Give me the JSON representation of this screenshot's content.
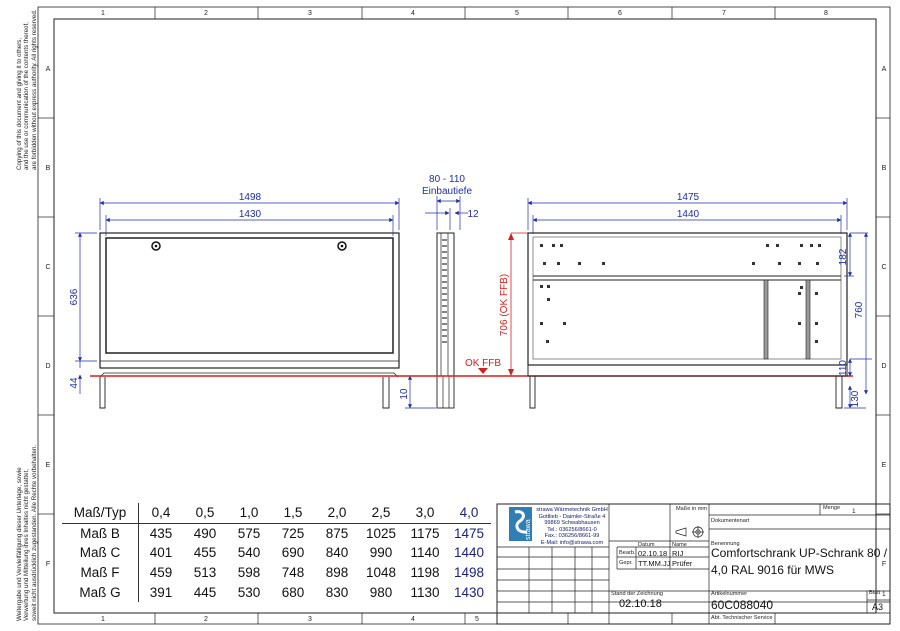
{
  "frame": {
    "col_numbers": [
      "1",
      "2",
      "3",
      "4",
      "5",
      "6",
      "7",
      "8"
    ],
    "row_letters": [
      "A",
      "B",
      "C",
      "D",
      "E",
      "F"
    ]
  },
  "side_notes": {
    "copyright_en": [
      "Copying of this document and giving it to others,",
      "and the use or communication of the contents thereof,",
      "are forbidden without express authority. All rights reserved."
    ],
    "copyright_de": [
      "Weitergabe und Vervielfältigung dieser Unterlage, sowie",
      "Verwertung und Mitteilung ihres Inhaltes nicht gestattet,",
      "soweit nicht ausdrücklich zugestanden. Alle Rechte vorbehalten."
    ]
  },
  "front_view": {
    "dim_overall_width": "1498",
    "dim_inner_width": "1430",
    "dim_height": "636",
    "dim_offset": "44"
  },
  "side_view": {
    "depth_range": "80 - 110",
    "depth_label": "Einbautiefe",
    "dim_frame": "12",
    "dim_foot": "10",
    "ok_ffb_label": "OK FFB",
    "height_label": "706 (OK FFB)"
  },
  "back_view": {
    "dim_overall_width": "1475",
    "dim_inner_width": "1440",
    "dim_top": "182",
    "dim_height": "760",
    "dim_bottom": "110",
    "dim_foot": "130"
  },
  "dimension_table": {
    "header_label": "Maß/Typ",
    "types": [
      "0,4",
      "0,5",
      "1,0",
      "1,5",
      "2,0",
      "2,5",
      "3,0",
      "4,0"
    ],
    "rows": [
      {
        "label": "Maß B",
        "values": [
          "435",
          "490",
          "575",
          "725",
          "875",
          "1025",
          "1175",
          "1475"
        ]
      },
      {
        "label": "Maß C",
        "values": [
          "401",
          "455",
          "540",
          "690",
          "840",
          "990",
          "1140",
          "1440"
        ]
      },
      {
        "label": "Maß F",
        "values": [
          "459",
          "513",
          "598",
          "748",
          "898",
          "1048",
          "1198",
          "1498"
        ]
      },
      {
        "label": "Maß G",
        "values": [
          "391",
          "445",
          "530",
          "680",
          "830",
          "980",
          "1130",
          "1430"
        ]
      }
    ]
  },
  "title_block": {
    "company_address": "strawa Wärmetechnik GmbH\nGottlieb - Daimler-Straße 4\n99869 Schwabhausen\nTel.: 036256/8661-0\nFax.: 036256/8661-99\nE-Mail: info@strawa.com",
    "logo_text": "strawa",
    "masse_label": "Maße in mm",
    "menge_label": "Menge",
    "menge_value": "1",
    "dokumentenart_label": "Dokumentenart",
    "benennung_label": "Benennung",
    "benennung_line1": "Comfortschrank UP-Schrank 80 /",
    "benennung_line2": "4,0 RAL 9016 für MWS",
    "datum_label": "Datum",
    "name_label": "Name",
    "bearb_label": "Bearb.",
    "bearb_date": "02.10.18",
    "bearb_name": "RIJ",
    "gepr_label": "Gepr.",
    "gepr_date": "TT.MM.JJ",
    "gepr_name": "Prüfer",
    "stand_label": "Stand der Zeichnung",
    "stand_value": "02.10.18",
    "artikel_label": "Artikelnummer",
    "artikel_value": "60C088040",
    "blatt_label": "Blatt",
    "blatt_value": "1",
    "format_value": "A3",
    "abt_label": "Abt. Technischer Service"
  }
}
